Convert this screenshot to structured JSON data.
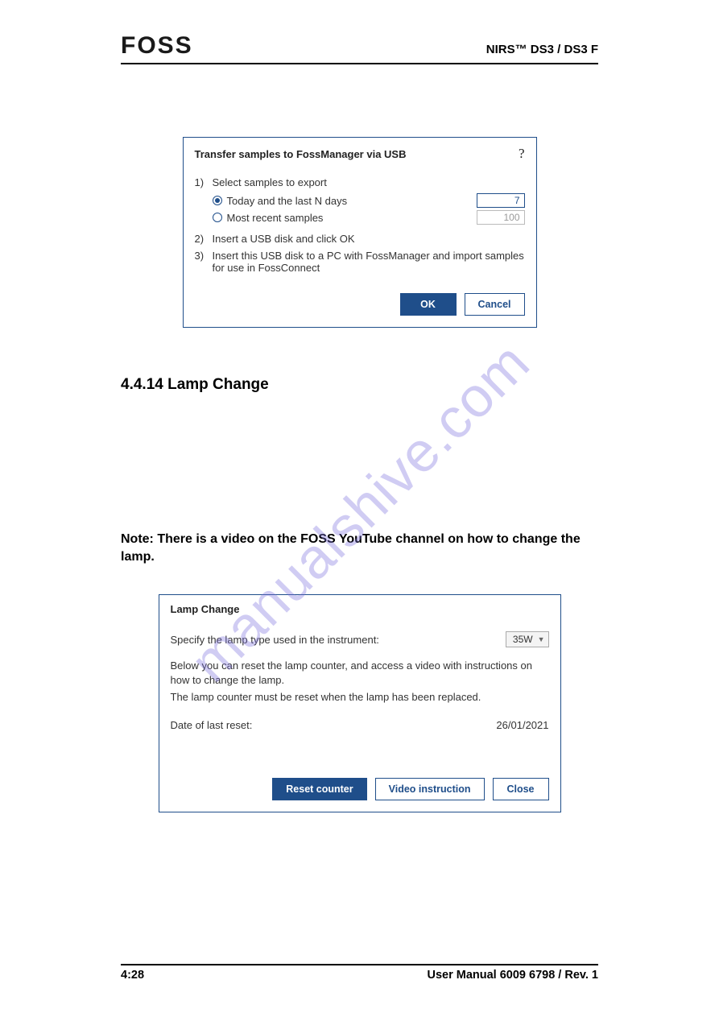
{
  "header": {
    "logo": "FOSS",
    "doc_title": "NIRS™ DS3 / DS3 F"
  },
  "watermark": "manualshive.com",
  "dialog1": {
    "title": "Transfer samples to FossManager via USB",
    "help": "?",
    "step1_num": "1)",
    "step1_text": "Select samples to export",
    "radio1_label": "Today and the last N days",
    "radio1_value": "7",
    "radio2_label": "Most recent samples",
    "radio2_value": "100",
    "step2_num": "2)",
    "step2_text": "Insert a USB disk and click OK",
    "step3_num": "3)",
    "step3_text": "Insert this USB disk to a PC with FossManager and import samples for use in FossConnect",
    "ok": "OK",
    "cancel": "Cancel"
  },
  "section": {
    "heading": "4.4.14 Lamp Change",
    "note": "Note: There is a video on the FOSS YouTube channel on how to change the lamp."
  },
  "dialog2": {
    "title": "Lamp Change",
    "specify_label": "Specify the lamp type used in the instrument:",
    "lamp_type": "35W",
    "desc1": "Below you can reset the lamp counter, and access a video with instructions on how to change the lamp.",
    "desc2": "The lamp counter must be reset when the lamp has been replaced.",
    "date_label": "Date of last reset:",
    "date_value": "26/01/2021",
    "reset": "Reset counter",
    "video": "Video instruction",
    "close": "Close"
  },
  "footer": {
    "page": "4:28",
    "manual": "User Manual 6009 6798 / Rev. 1"
  }
}
